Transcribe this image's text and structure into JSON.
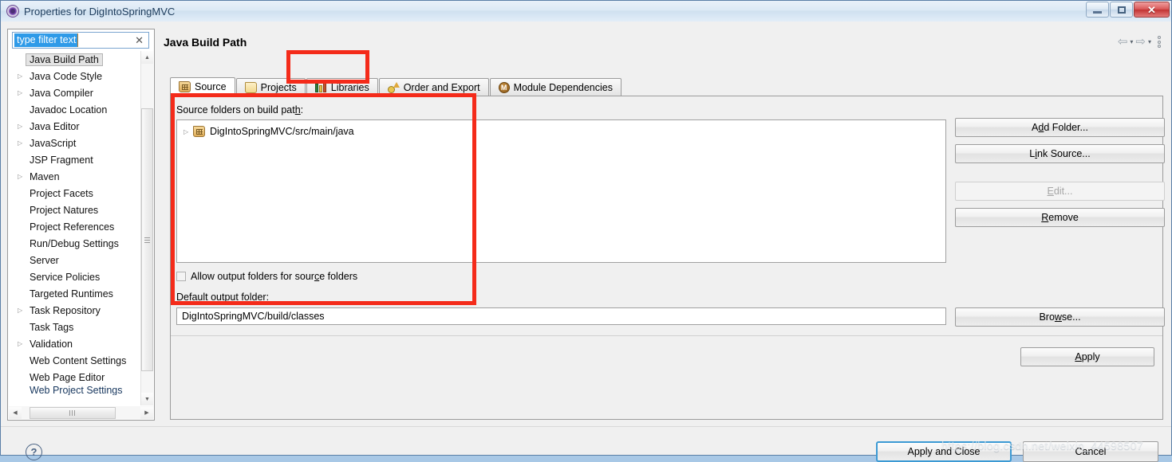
{
  "window": {
    "title": "Properties for DigIntoSpringMVC",
    "icon": "eclipse-properties-icon",
    "controls": {
      "minimize": "–",
      "restore": "❐",
      "close": "✕"
    }
  },
  "sidebar": {
    "filter": {
      "value": "type filter text",
      "clear_label": "✕"
    },
    "items": [
      {
        "label": "Java Build Path",
        "expandable": false,
        "selected": true
      },
      {
        "label": "Java Code Style",
        "expandable": true,
        "selected": false
      },
      {
        "label": "Java Compiler",
        "expandable": true,
        "selected": false
      },
      {
        "label": "Javadoc Location",
        "expandable": false,
        "selected": false
      },
      {
        "label": "Java Editor",
        "expandable": true,
        "selected": false
      },
      {
        "label": "JavaScript",
        "expandable": true,
        "selected": false
      },
      {
        "label": "JSP Fragment",
        "expandable": false,
        "selected": false
      },
      {
        "label": "Maven",
        "expandable": true,
        "selected": false
      },
      {
        "label": "Project Facets",
        "expandable": false,
        "selected": false
      },
      {
        "label": "Project Natures",
        "expandable": false,
        "selected": false
      },
      {
        "label": "Project References",
        "expandable": false,
        "selected": false
      },
      {
        "label": "Run/Debug Settings",
        "expandable": false,
        "selected": false
      },
      {
        "label": "Server",
        "expandable": false,
        "selected": false
      },
      {
        "label": "Service Policies",
        "expandable": false,
        "selected": false
      },
      {
        "label": "Targeted Runtimes",
        "expandable": false,
        "selected": false
      },
      {
        "label": "Task Repository",
        "expandable": true,
        "selected": false
      },
      {
        "label": "Task Tags",
        "expandable": false,
        "selected": false
      },
      {
        "label": "Validation",
        "expandable": true,
        "selected": false
      },
      {
        "label": "Web Content Settings",
        "expandable": false,
        "selected": false
      },
      {
        "label": "Web Page Editor",
        "expandable": false,
        "selected": false
      },
      {
        "label": "Web Project Settings",
        "expandable": false,
        "selected": false
      }
    ]
  },
  "page": {
    "title": "Java Build Path",
    "nav": {
      "back": "⇦",
      "back_caret": "▾",
      "forward": "⇨",
      "forward_caret": "▾",
      "menu": "⋮"
    }
  },
  "tabs": [
    {
      "label": "Source",
      "icon": "package-icon",
      "active": true
    },
    {
      "label": "Projects",
      "icon": "folder-icon",
      "active": false
    },
    {
      "label": "Libraries",
      "icon": "books-icon",
      "active": false
    },
    {
      "label": "Order and Export",
      "icon": "order-icon",
      "active": false
    },
    {
      "label": "Module Dependencies",
      "icon": "module-icon",
      "active": false
    }
  ],
  "source_tab": {
    "list_label": "Source folders on build path:",
    "entries": [
      {
        "label": "DigIntoSpringMVC/src/main/java",
        "icon": "package-icon",
        "expandable": true
      }
    ],
    "buttons": [
      {
        "label": "Add Folder...",
        "mnemonic": "d",
        "enabled": true
      },
      {
        "label": "Link Source...",
        "mnemonic": "i",
        "enabled": true
      },
      {
        "label": "Edit...",
        "mnemonic": "E",
        "enabled": false
      },
      {
        "label": "Remove",
        "mnemonic": "R",
        "enabled": true
      }
    ],
    "allow_output_checkbox": {
      "label": "Allow output folders for source folders",
      "checked": false
    },
    "default_output_label": "Default output folder:",
    "default_output_value": "DigIntoSpringMVC/build/classes",
    "browse_button": {
      "label": "Browse...",
      "mnemonic": "w"
    },
    "apply_button": {
      "label": "Apply",
      "mnemonic": "A"
    }
  },
  "footer": {
    "help_icon": "?",
    "apply_and_close": "Apply and Close",
    "cancel": "Cancel"
  },
  "watermark": "https://blog.csdn.net/weixin_44598507",
  "annotations": {
    "colors": {
      "highlight": "#f42b1a",
      "accent": "#3c9ad4",
      "selection": "#2e9ae8"
    }
  }
}
